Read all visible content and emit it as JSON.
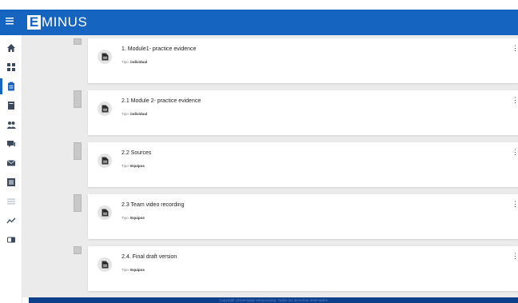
{
  "header": {
    "logo_letter": "E",
    "logo_text": "MINUS",
    "brand_color": "#1565c0"
  },
  "sidebar": {
    "items": [
      {
        "icon": "home-icon"
      },
      {
        "icon": "grid-icon"
      },
      {
        "icon": "clipboard-icon",
        "active": true
      },
      {
        "icon": "book-icon"
      },
      {
        "icon": "users-icon"
      },
      {
        "icon": "chat-icon"
      },
      {
        "icon": "mail-icon"
      },
      {
        "icon": "gradebook-icon"
      },
      {
        "icon": "list-icon"
      },
      {
        "icon": "analytics-icon"
      },
      {
        "icon": "toggle-icon"
      }
    ]
  },
  "activities": [
    {
      "title": "1. Module1- practice evidence",
      "type_label": "Tipo:",
      "type_value": "individual"
    },
    {
      "title": "2.1 Module 2- practice evidence",
      "type_label": "Tipo:",
      "type_value": "individual"
    },
    {
      "title": "2.2 Sources",
      "type_label": "Tipo:",
      "type_value": "Equipos"
    },
    {
      "title": "2.3 Team video recording",
      "type_label": "Tipo:",
      "type_value": "Equipos"
    },
    {
      "title": "2.4. Final draft version",
      "type_label": "Tipo:",
      "type_value": "Equipos"
    }
  ],
  "footer": {
    "text": "Copyright Universidad Veracruzana. Todos los derechos reservados"
  }
}
